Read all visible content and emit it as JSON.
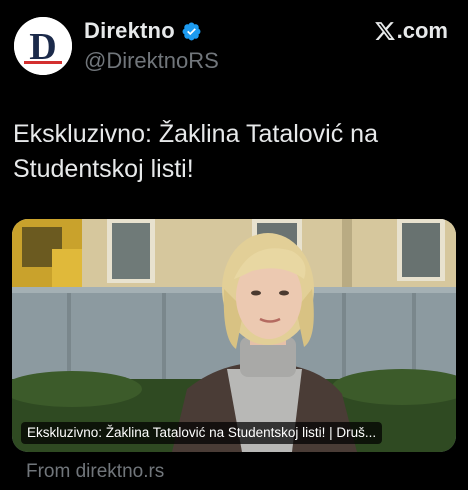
{
  "post": {
    "display_name": "Direktno",
    "handle": "@DirektnoRS",
    "avatar_letter": "D",
    "verified_icon": "verified-badge-icon",
    "text": "Ekskluzivno: Žaklina Tatalović na Studentskoj listi!"
  },
  "brand": {
    "label": ".com",
    "icon": "x-logo-icon"
  },
  "link_card": {
    "title": "Ekskluzivno: Žaklina Tatalović na Studentskoj listi! | Druš...",
    "source": "From direktno.rs"
  },
  "colors": {
    "background": "#000000",
    "text_primary": "#e7e9ea",
    "text_secondary": "#71767b",
    "verified_blue": "#1d9bf0",
    "avatar_navy": "#1b2a4a",
    "avatar_red": "#d32f2f"
  }
}
